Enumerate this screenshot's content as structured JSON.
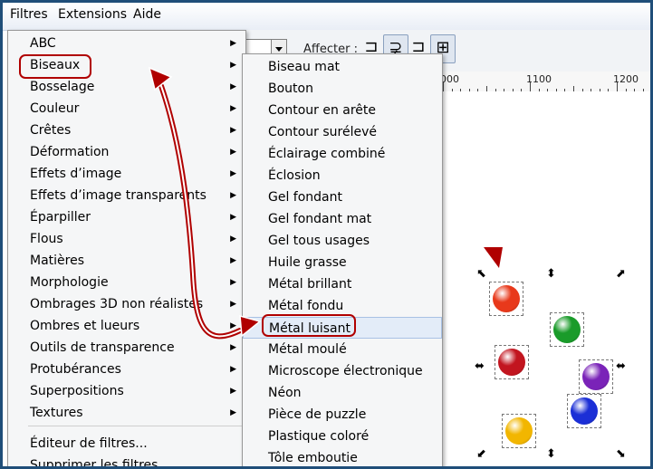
{
  "menubar": {
    "items": [
      "Filtres",
      "Extensions",
      "Aide"
    ]
  },
  "toolbar": {
    "affecter_label": "Affecter :"
  },
  "ruler": {
    "labels": [
      "000",
      "1100",
      "1200"
    ]
  },
  "filters_menu": {
    "items": [
      {
        "label": "ABC",
        "has_submenu": true
      },
      {
        "label": "Biseaux",
        "has_submenu": true
      },
      {
        "label": "Bosselage",
        "has_submenu": true
      },
      {
        "label": "Couleur",
        "has_submenu": true
      },
      {
        "label": "Crêtes",
        "has_submenu": true
      },
      {
        "label": "Déformation",
        "has_submenu": true
      },
      {
        "label": "Effets d’image",
        "has_submenu": true
      },
      {
        "label": "Effets d’image transparents",
        "has_submenu": true
      },
      {
        "label": "Éparpiller",
        "has_submenu": true
      },
      {
        "label": "Flous",
        "has_submenu": true
      },
      {
        "label": "Matières",
        "has_submenu": true
      },
      {
        "label": "Morphologie",
        "has_submenu": true
      },
      {
        "label": "Ombrages 3D non réalistes",
        "has_submenu": true
      },
      {
        "label": "Ombres et lueurs",
        "has_submenu": true
      },
      {
        "label": "Outils de transparence",
        "has_submenu": true
      },
      {
        "label": "Protubérances",
        "has_submenu": true
      },
      {
        "label": "Superpositions",
        "has_submenu": true
      },
      {
        "label": "Textures",
        "has_submenu": true
      }
    ],
    "footer_items": [
      "Éditeur de filtres...",
      "Supprimer les filtres"
    ]
  },
  "biseaux_submenu": {
    "items": [
      "Biseau mat",
      "Bouton",
      "Contour en arête",
      "Contour surélevé",
      "Éclairage combiné",
      "Éclosion",
      "Gel fondant",
      "Gel fondant mat",
      "Gel tous usages",
      "Huile grasse",
      "Métal brillant",
      "Métal fondu",
      "Métal luisant",
      "Métal moulé",
      "Microscope électronique",
      "Néon",
      "Pièce de puzzle",
      "Plastique coloré",
      "Tôle emboutie"
    ],
    "highlighted": "Métal luisant"
  },
  "colors": {
    "accent_red": "#b00000",
    "ball_colors": [
      "#e8391b",
      "#1a9b2a",
      "#c2151f",
      "#7a23b8",
      "#1b2fd6",
      "#f2b600"
    ]
  }
}
